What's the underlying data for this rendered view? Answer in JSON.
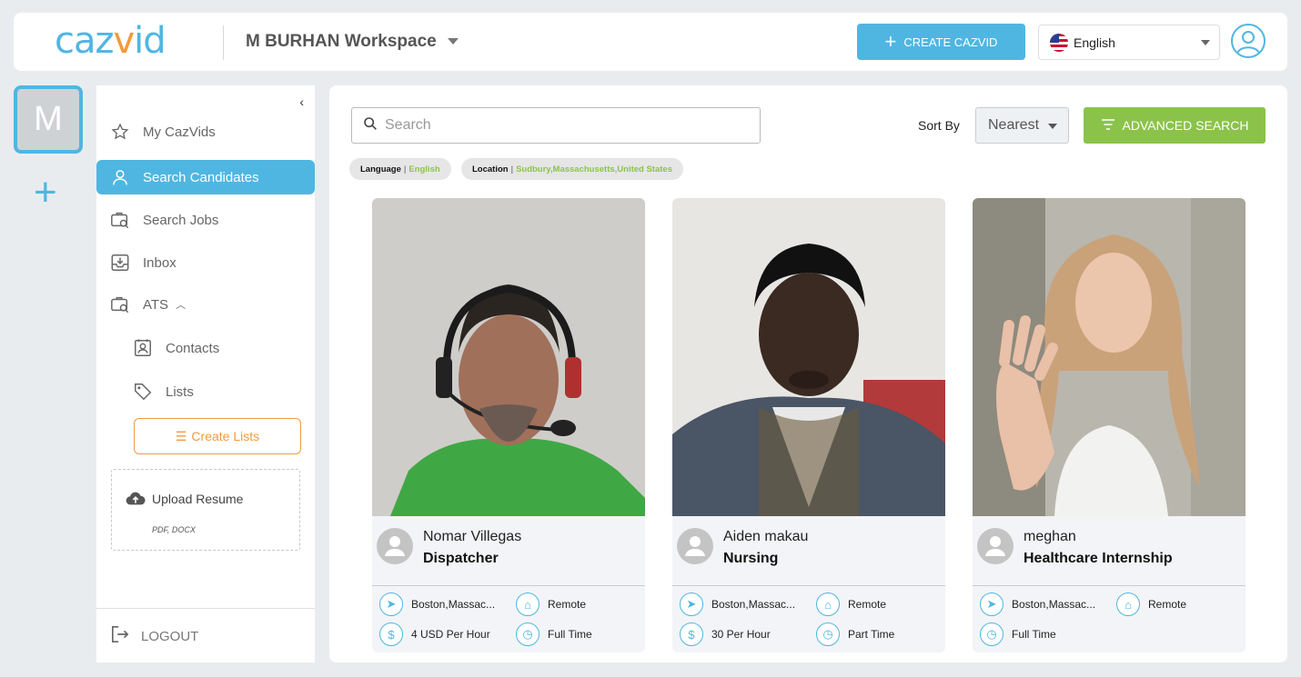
{
  "brand": {
    "logo_part1": "caz",
    "logo_part2": "v",
    "logo_part3": "id",
    "accent": "#4fb6e2",
    "orange": "#f39a3b",
    "green": "#8bc34a"
  },
  "header": {
    "workspace": "M BURHAN Workspace",
    "create_button": "CREATE CAZVID",
    "language": "English"
  },
  "rail": {
    "workspace_initial": "M"
  },
  "sidebar": {
    "items": [
      {
        "label": "My CazVids",
        "icon": "star-icon"
      },
      {
        "label": "Search Candidates",
        "icon": "person-icon"
      },
      {
        "label": "Search Jobs",
        "icon": "briefcase-search-icon"
      },
      {
        "label": "Inbox",
        "icon": "inbox-icon"
      },
      {
        "label": "ATS",
        "icon": "briefcase-search-icon"
      },
      {
        "label": "Contacts",
        "icon": "contact-card-icon"
      },
      {
        "label": "Lists",
        "icon": "tag-icon"
      }
    ],
    "create_lists": "Create Lists",
    "upload_resume": "Upload Resume",
    "upload_formats": "PDF, DOCX",
    "logout": "LOGOUT"
  },
  "main": {
    "search_placeholder": "Search",
    "sort_label": "Sort By",
    "sort_value": "Nearest",
    "advanced_search": "ADVANCED SEARCH",
    "filters": [
      {
        "key": "Language",
        "value": "English"
      },
      {
        "key": "Location",
        "value": "Sudbury,Massachusetts,United States"
      }
    ]
  },
  "candidates": [
    {
      "name": "Nomar Villegas",
      "role": "Dispatcher",
      "location": "Boston,Massac...",
      "workplace": "Remote",
      "pay": "4 USD Per Hour",
      "type": "Full Time"
    },
    {
      "name": "Aiden makau",
      "role": "Nursing",
      "location": "Boston,Massac...",
      "workplace": "Remote",
      "pay": "30 Per Hour",
      "type": "Part Time"
    },
    {
      "name": "meghan",
      "role": "Healthcare Internship",
      "location": "Boston,Massac...",
      "workplace": "Remote",
      "type": "Full Time"
    }
  ]
}
